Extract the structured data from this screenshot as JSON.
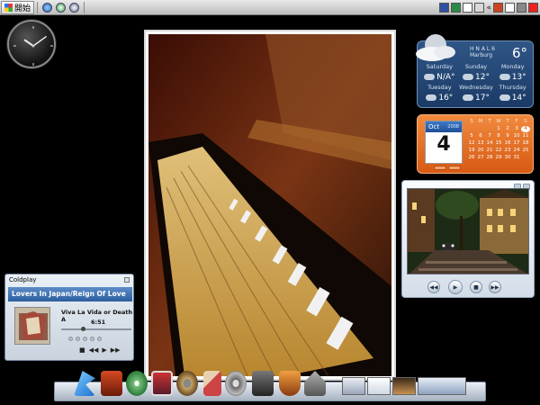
{
  "taskbar": {
    "start_label": "開始",
    "quicklaunch": [
      "ie-icon",
      "messenger-icon",
      "show-desktop-icon"
    ],
    "tray": [
      "tray-app-icon",
      "tray-green-icon",
      "tray-doc-icon",
      "tray-window-icon",
      "tray-shield-icon",
      "tray-flag-icon",
      "tray-network-icon",
      "tray-close-icon"
    ]
  },
  "clock": {
    "hour": 10,
    "minute": 9
  },
  "weather": {
    "location_top": "H N A L 6",
    "location": "Marburg",
    "current_temp": "6°",
    "days": [
      {
        "day": "Saturday",
        "temp": "N/A°"
      },
      {
        "day": "Sunday",
        "temp": "12°"
      },
      {
        "day": "Monday",
        "temp": "13°"
      },
      {
        "day": "Tuesday",
        "temp": "16°"
      },
      {
        "day": "Wednesday",
        "temp": "17°"
      },
      {
        "day": "Thursday",
        "temp": "14°"
      }
    ]
  },
  "calendar": {
    "month": "Oct",
    "year": "2008",
    "day": "4",
    "weekdays": [
      "S",
      "M",
      "T",
      "W",
      "T",
      "F",
      "S"
    ],
    "dates": [
      "",
      "",
      "",
      "1",
      "2",
      "3",
      "4",
      "5",
      "6",
      "7",
      "8",
      "9",
      "10",
      "11",
      "12",
      "13",
      "14",
      "15",
      "16",
      "17",
      "18",
      "19",
      "20",
      "21",
      "22",
      "23",
      "24",
      "25",
      "26",
      "27",
      "28",
      "29",
      "30",
      "31",
      ""
    ],
    "today": "4"
  },
  "player": {
    "header": "Coldplay",
    "album": "Lovers In Japan/Reign Of Love",
    "track": "Viva La Vida or Death A",
    "time": "6:51",
    "progress": 0.31,
    "controls": [
      "■",
      "◀◀",
      "▶",
      "▶▶"
    ]
  },
  "slideshow": {
    "controls": [
      "◀◀",
      "▶",
      "■",
      "▶▶"
    ]
  },
  "dock": {
    "icons": [
      "bird-icon",
      "bottles-icon",
      "music-disc-icon",
      "settings-icon",
      "cd-drive-icon",
      "paint-tool-icon",
      "film-reel-icon",
      "camera-icon",
      "bowl-icon",
      "house-icon"
    ],
    "windows": [
      "window-thumb-1",
      "window-thumb-2",
      "window-thumb-3",
      "window-thumb-4"
    ]
  }
}
